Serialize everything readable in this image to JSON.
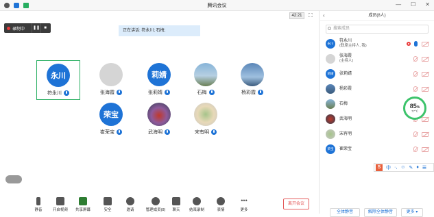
{
  "window": {
    "title": "腾讯会议"
  },
  "header": {
    "timer": "42:21"
  },
  "recording": {
    "label": "录制中"
  },
  "speaking": {
    "text": "正在讲话: 符永川; 石梅;"
  },
  "participants": [
    {
      "avatar_text": "永川",
      "name": "符永川",
      "avatar": "blue"
    },
    {
      "avatar_text": "",
      "name": "张海霞",
      "avatar": "gray"
    },
    {
      "avatar_text": "莉婧",
      "name": "张莉婧",
      "avatar": "blue"
    },
    {
      "avatar_text": "",
      "name": "石梅",
      "avatar": "photo1"
    },
    {
      "avatar_text": "",
      "name": "杨彩霞",
      "avatar": "photo2"
    },
    {
      "avatar_text": "荣宝",
      "name": "崔荣宝",
      "avatar": "blue"
    },
    {
      "avatar_text": "",
      "name": "武海明",
      "avatar": "photo3"
    },
    {
      "avatar_text": "",
      "name": "宋有明",
      "avatar": "photo4"
    }
  ],
  "toolbar": {
    "mute": "静音",
    "video": "开启视频",
    "share": "共享屏幕",
    "security": "安全",
    "invite": "邀请",
    "manage": "管理成员(8)",
    "chat": "聊天",
    "end_record": "结束录制",
    "emoji": "表情",
    "more": "更多",
    "leave": "离开会议"
  },
  "panel": {
    "title": "成员(8人)",
    "search_placeholder": "搜索成员",
    "members": [
      {
        "avatar_text": "永川",
        "name": "符永川",
        "sub": "(联席主持人, 我)"
      },
      {
        "avatar_text": "",
        "name": "张海霞",
        "sub": "(主持人)"
      },
      {
        "avatar_text": "莉婧",
        "name": "张莉婧",
        "sub": ""
      },
      {
        "avatar_text": "",
        "name": "杨彩霞",
        "sub": ""
      },
      {
        "avatar_text": "",
        "name": "石梅",
        "sub": ""
      },
      {
        "avatar_text": "",
        "name": "武海明",
        "sub": ""
      },
      {
        "avatar_text": "",
        "name": "宋有明",
        "sub": ""
      },
      {
        "avatar_text": "荣宝",
        "name": "崔荣宝",
        "sub": ""
      }
    ],
    "mute_all": "全体静音",
    "unmute_all": "解除全体静音",
    "more": "更多"
  },
  "gauge": {
    "percent": "85",
    "unit": "%",
    "temp": "77℃"
  },
  "ime": {
    "logo": "S"
  },
  "colors": {
    "accent": "#1e73d6",
    "active_border": "#27ae60",
    "danger": "#e45b5b"
  }
}
